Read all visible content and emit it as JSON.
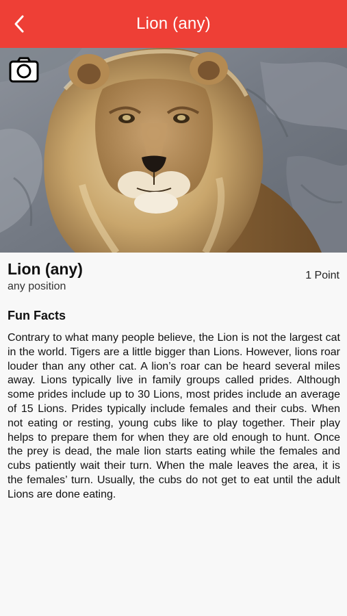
{
  "nav": {
    "title": "Lion (any)",
    "back_icon": "chevron-left-icon"
  },
  "photo": {
    "subject": "lion",
    "camera_icon": "camera-icon"
  },
  "animal": {
    "name": "Lion (any)",
    "position": "any position",
    "points": "1 Point"
  },
  "facts": {
    "title": "Fun Facts",
    "body": "Contrary to what many people believe, the Lion is not the largest cat in the world. Tigers are a little bigger than Lions. However, lions roar louder than any other cat. A lion’s roar can be heard several miles away. Lions typically live in family groups called prides. Although some prides include up to 30 Lions, most prides include an average of 15 Lions. Prides typically include females and their cubs. When not eating or resting, young cubs like to play together. Their play helps to prepare them for when they are old enough to hunt. Once the prey is dead, the male lion starts eating while the females and cubs patiently wait their turn. When the male leaves the area, it is the females’ turn. Usually, the cubs do not get to eat until the adult Lions are done eating."
  },
  "colors": {
    "header_red": "#ee3f36",
    "background": "#f8f8f8"
  }
}
